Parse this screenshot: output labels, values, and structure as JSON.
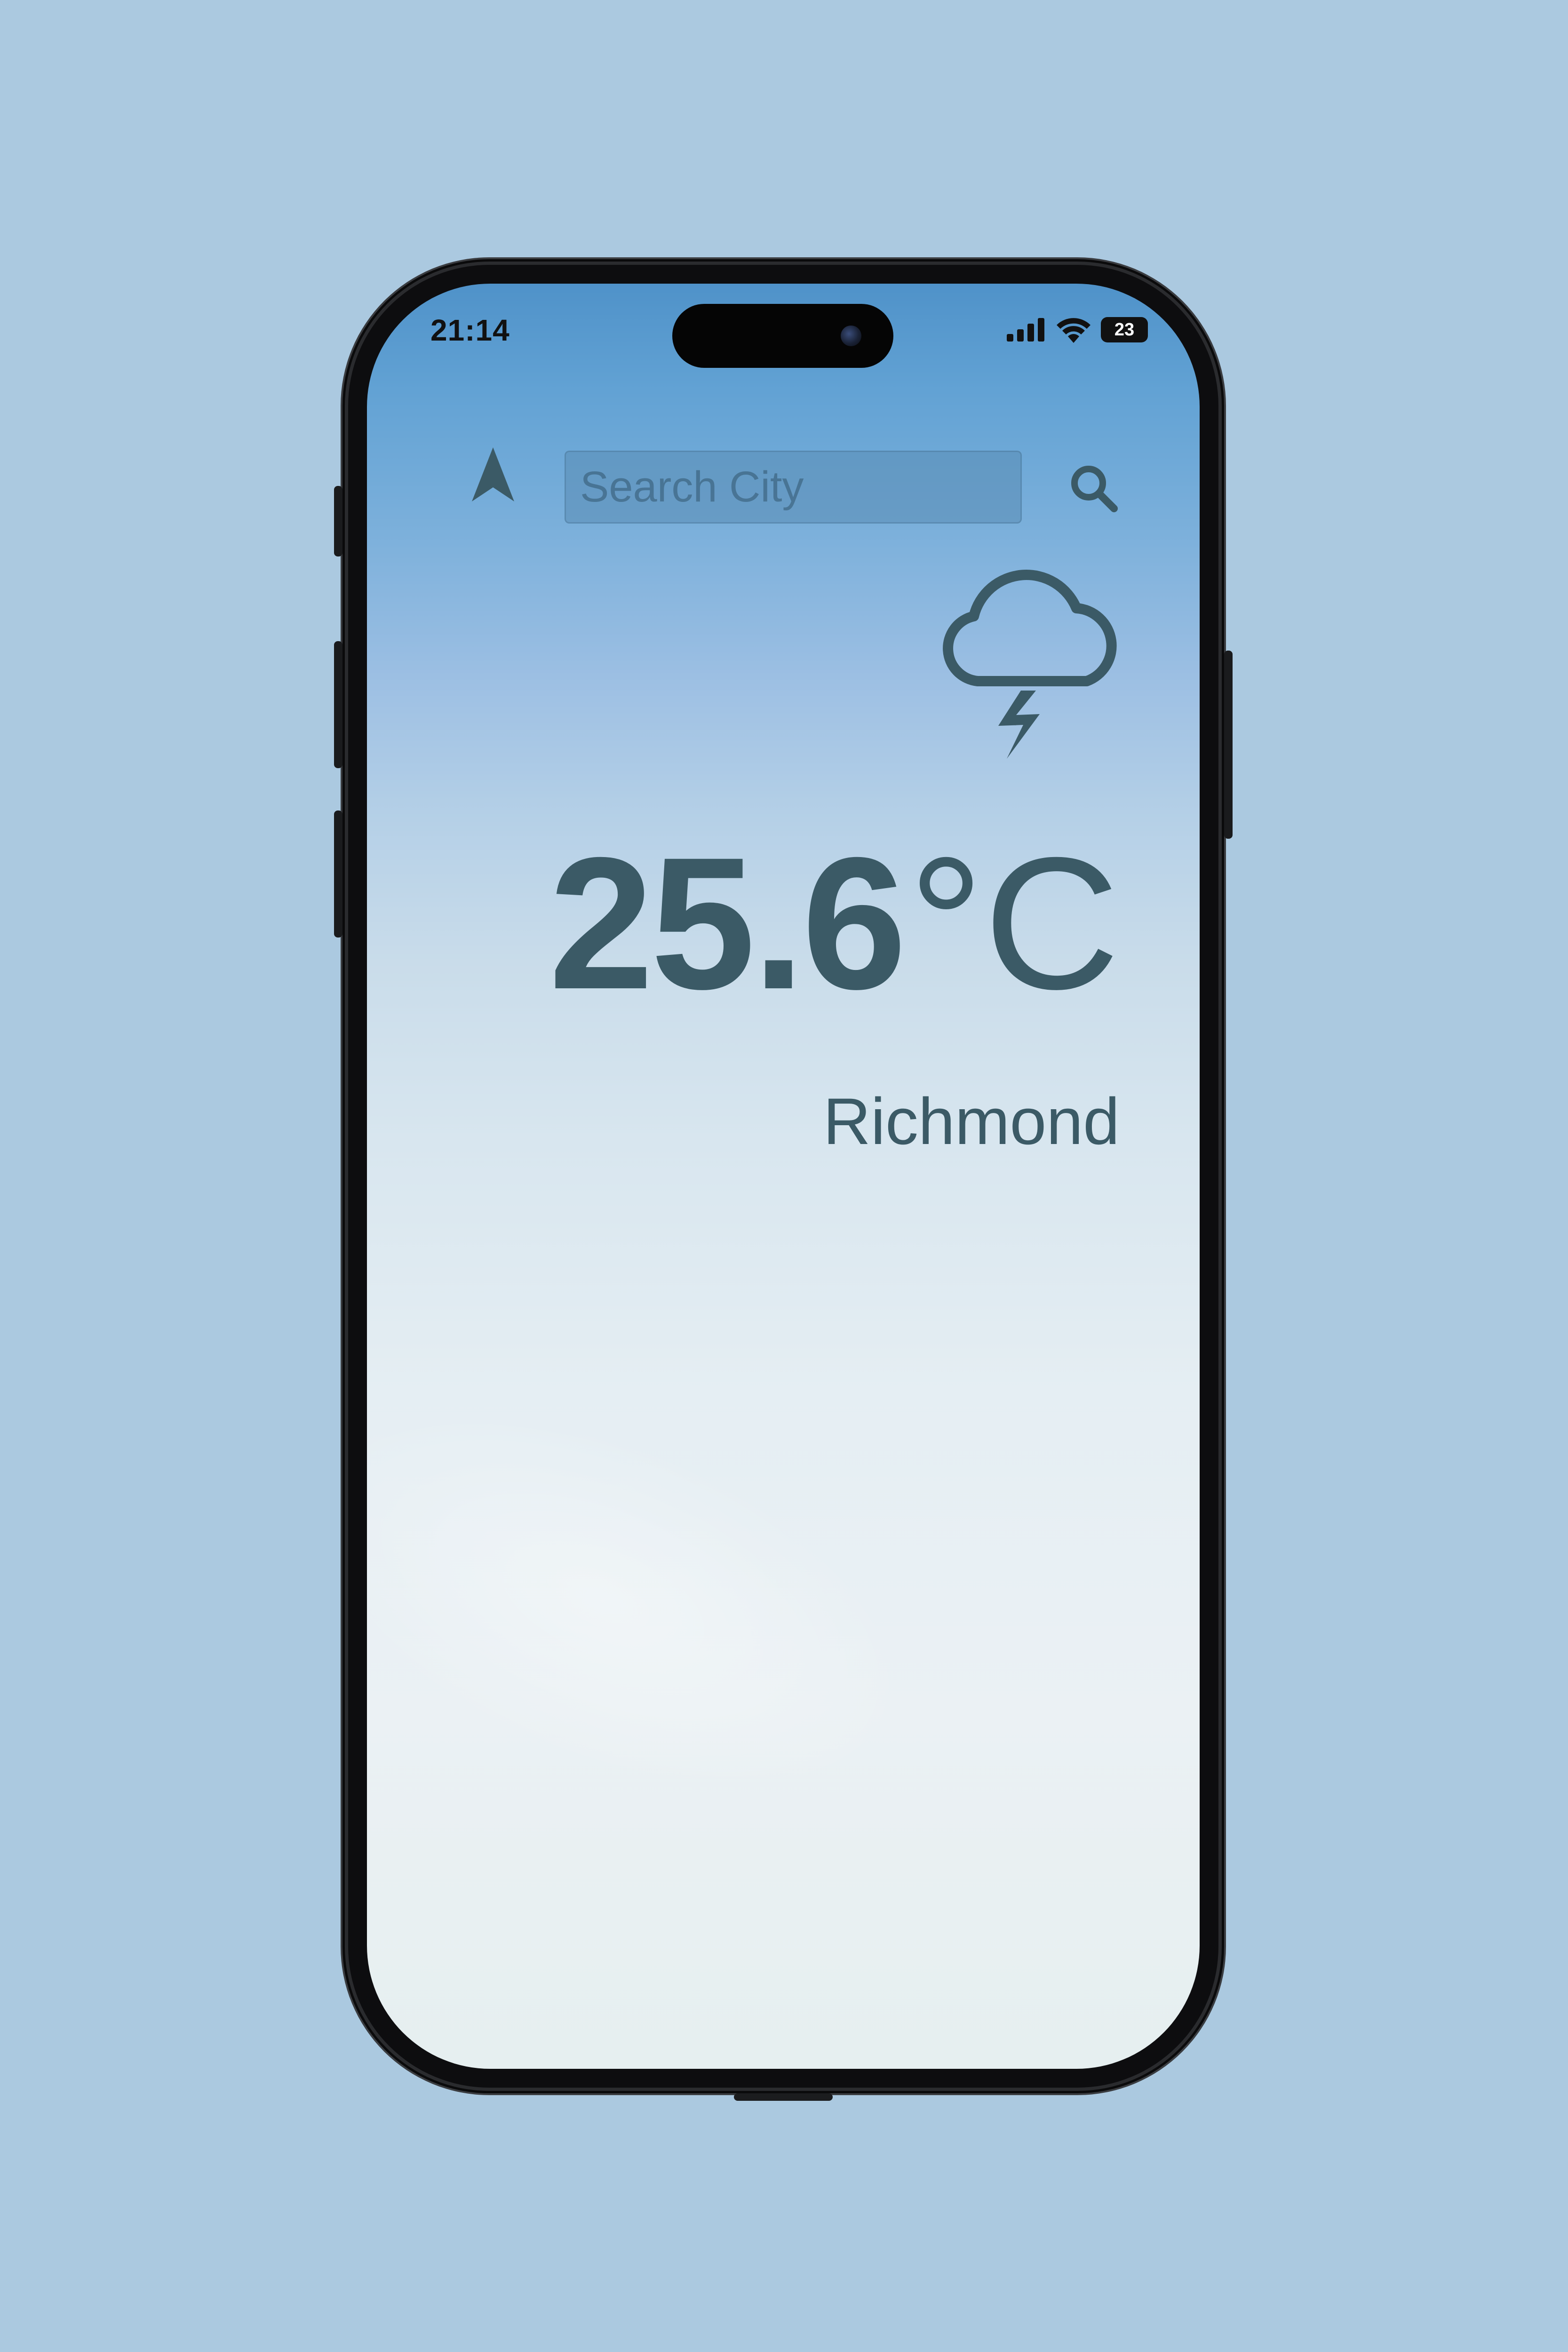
{
  "status_bar": {
    "time": "21:14",
    "battery_level": "23",
    "icons": [
      "signal-icon",
      "wifi-icon",
      "battery-icon"
    ]
  },
  "search": {
    "placeholder": "Search City",
    "value": ""
  },
  "weather": {
    "condition_icon": "cloud-lightning-icon",
    "temperature": "25.6",
    "unit": "°C",
    "city": "Richmond"
  },
  "colors": {
    "background": "#abc9e0",
    "text": "#3b5a66",
    "gradient_top": "#4f92c9",
    "gradient_bottom": "#e6eff0"
  }
}
